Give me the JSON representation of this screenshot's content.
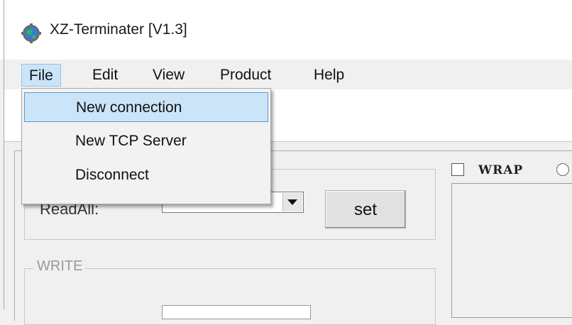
{
  "window": {
    "title": "XZ-Terminater [V1.3]",
    "icon": "globe-gear-icon"
  },
  "menubar": {
    "items": [
      "File",
      "Edit",
      "View",
      "Product",
      "Help"
    ],
    "open_menu": "File"
  },
  "file_menu": {
    "items": [
      {
        "label": "New connection",
        "highlighted": true
      },
      {
        "label": "New TCP Server",
        "highlighted": false
      },
      {
        "label": "Disconnect",
        "highlighted": false
      }
    ]
  },
  "read_group": {
    "readall_label": "ReadAll:",
    "combo_value": "***",
    "set_label": "set"
  },
  "write_group": {
    "label": "WRITE"
  },
  "output": {
    "wrap_label": "WRAP",
    "wrap_checked": false
  },
  "colors": {
    "highlight": "#cce4f7",
    "highlight_border": "#5a9bd5",
    "window_bg": "#f0f0f0"
  }
}
